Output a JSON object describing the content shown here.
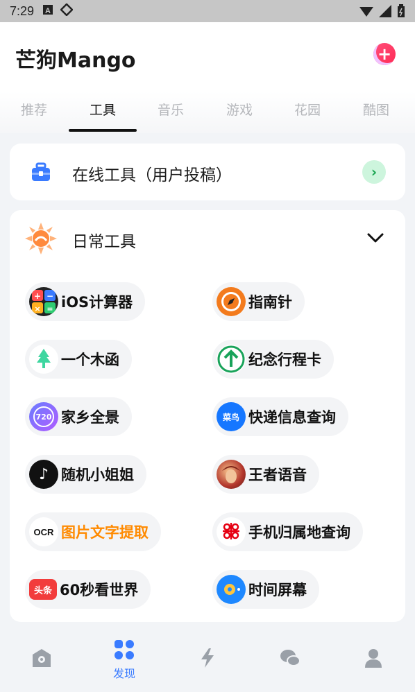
{
  "status_bar": {
    "time": "7:29"
  },
  "header": {
    "app_title": "芒狗Mango",
    "add_button": "+"
  },
  "tabs": [
    {
      "label": "推荐",
      "active": false
    },
    {
      "label": "工具",
      "active": true
    },
    {
      "label": "音乐",
      "active": false
    },
    {
      "label": "游戏",
      "active": false
    },
    {
      "label": "花园",
      "active": false
    },
    {
      "label": "酷图",
      "active": false
    }
  ],
  "online_tools": {
    "label": "在线工具（用户投稿）",
    "arrow": "›"
  },
  "daily_tools": {
    "label": "日常工具",
    "items": [
      {
        "label": "iOS计算器",
        "icon": "calculator-icon"
      },
      {
        "label": "指南针",
        "icon": "compass-icon"
      },
      {
        "label": "一个木函",
        "icon": "tree-icon"
      },
      {
        "label": "纪念行程卡",
        "icon": "up-arrow-icon"
      },
      {
        "label": "家乡全景",
        "icon": "panorama-720-icon",
        "icon_text": "720"
      },
      {
        "label": "快递信息查询",
        "icon": "cainiao-icon",
        "icon_text": "菜鸟"
      },
      {
        "label": "随机小姐姐",
        "icon": "tiktok-icon",
        "icon_text": "♪"
      },
      {
        "label": "王者语音",
        "icon": "game-avatar-icon"
      },
      {
        "label": "图片文字提取",
        "icon": "ocr-icon",
        "icon_text": "OCR",
        "highlight_color": "#ff8a00"
      },
      {
        "label": "手机归属地查询",
        "icon": "china-unicom-icon"
      },
      {
        "label": "60秒看世界",
        "icon": "toutiao-icon",
        "icon_text": "头条"
      },
      {
        "label": "时间屏幕",
        "icon": "clock-screen-icon"
      }
    ]
  },
  "bottom_nav": [
    {
      "name": "home",
      "label": ""
    },
    {
      "name": "discover",
      "label": "发现"
    },
    {
      "name": "flash",
      "label": ""
    },
    {
      "name": "chat",
      "label": ""
    },
    {
      "name": "profile",
      "label": ""
    }
  ],
  "colors": {
    "accent": "#3a7bff",
    "add_button": "#ff3b63",
    "arrow_bg": "#cdf5dd",
    "arrow_fg": "#17a44f"
  }
}
